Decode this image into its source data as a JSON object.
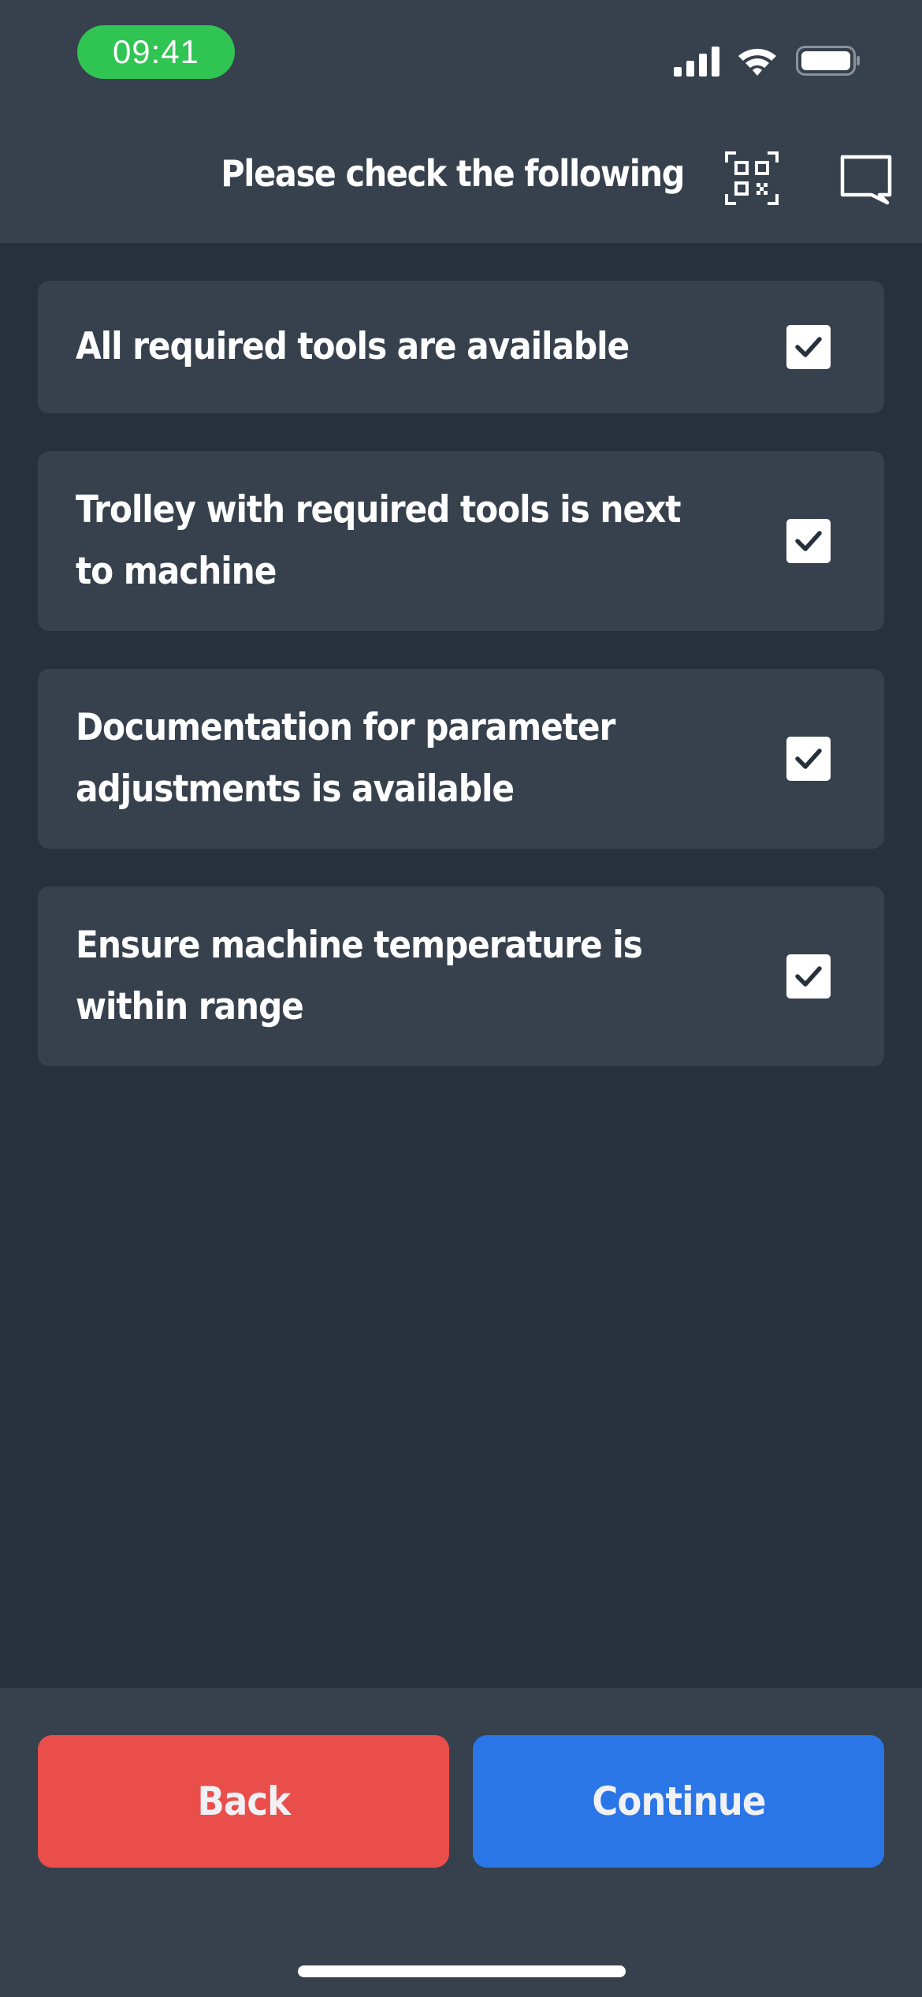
{
  "status_bar": {
    "time": "09:41",
    "signal_icon": "cellular-signal-icon",
    "wifi_icon": "wifi-icon",
    "battery_icon": "battery-icon"
  },
  "header": {
    "title": "Please check the following",
    "qr_icon": "qr-code-icon",
    "chat_icon": "chat-bubble-icon"
  },
  "checklist": {
    "items": [
      {
        "label": "All required tools are available",
        "checked": true
      },
      {
        "label": "Trolley with required tools is next to machine",
        "checked": true
      },
      {
        "label": "Documentation for parameter adjustments is available",
        "checked": true
      },
      {
        "label": "Ensure machine temperature is within range",
        "checked": true
      }
    ]
  },
  "footer": {
    "back_label": "Back",
    "continue_label": "Continue"
  },
  "colors": {
    "background": "#28313b",
    "surface": "#37414d",
    "back_button": "#ea4e4a",
    "continue_button": "#2a76e6",
    "time_pill": "#30c452"
  }
}
